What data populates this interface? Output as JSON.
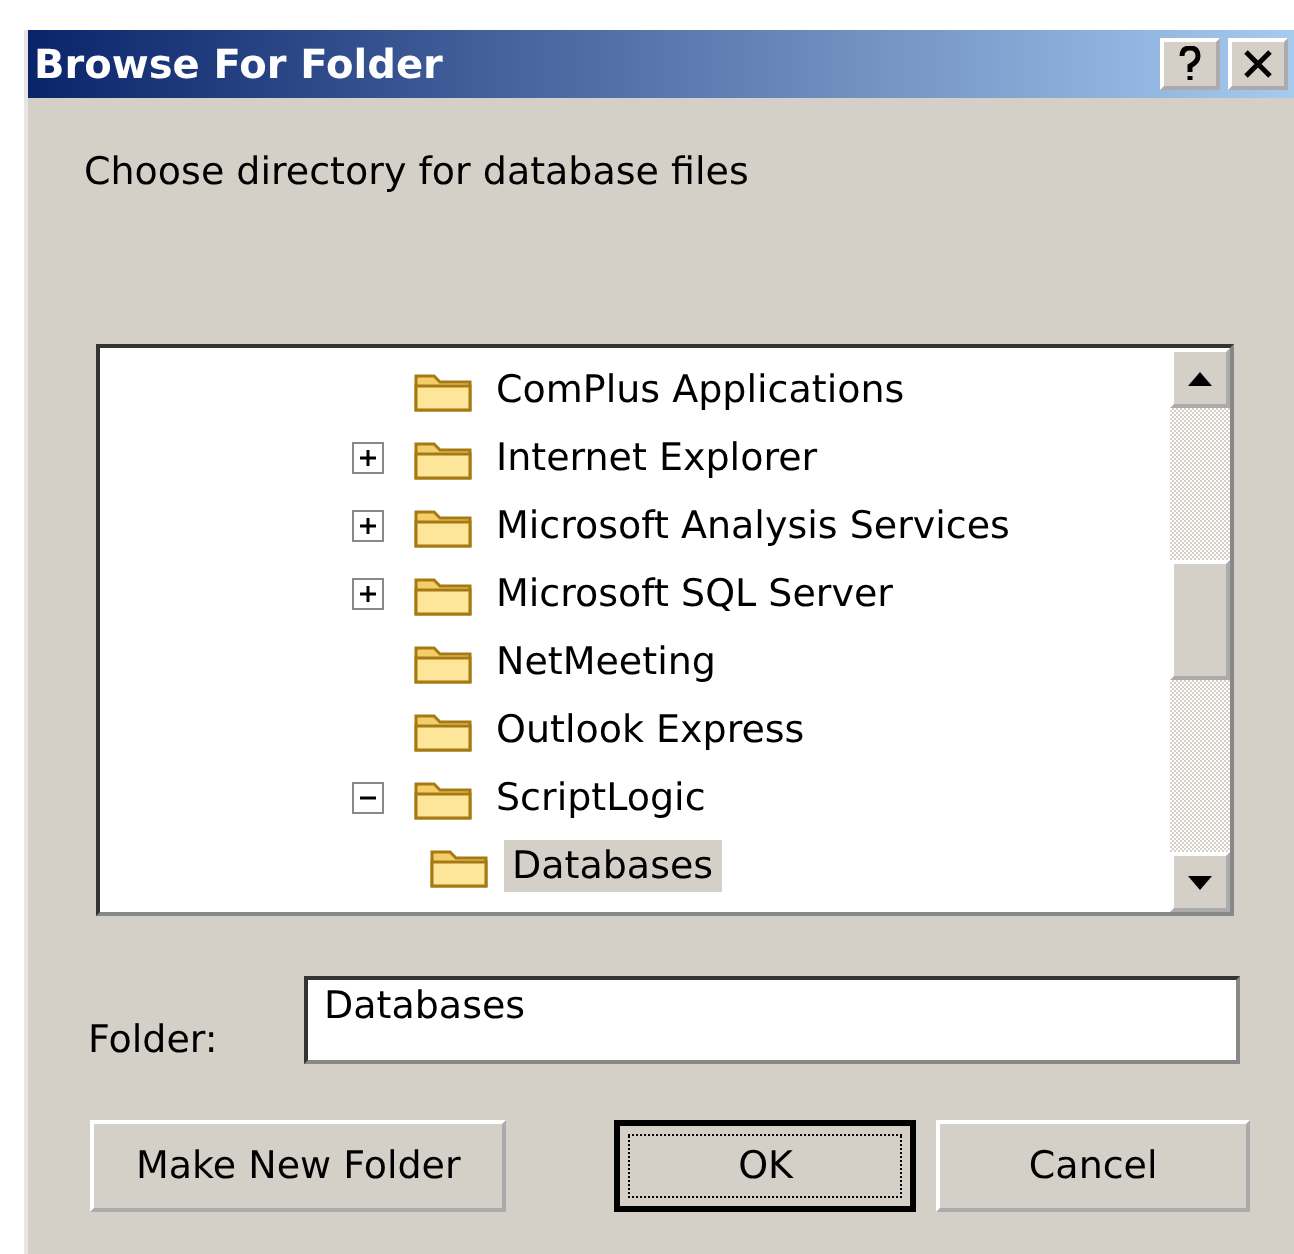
{
  "window": {
    "title": "Browse For Folder"
  },
  "prompt": "Choose directory for database files",
  "tree": {
    "items": [
      {
        "label": "ComPlus Applications",
        "kind": "leaf",
        "selected": false
      },
      {
        "label": "Internet Explorer",
        "kind": "collapsed",
        "selected": false
      },
      {
        "label": "Microsoft Analysis Services",
        "kind": "collapsed",
        "selected": false
      },
      {
        "label": "Microsoft SQL Server",
        "kind": "collapsed",
        "selected": false
      },
      {
        "label": "NetMeeting",
        "kind": "leaf",
        "selected": false
      },
      {
        "label": "Outlook Express",
        "kind": "leaf",
        "selected": false
      },
      {
        "label": "ScriptLogic",
        "kind": "expanded",
        "selected": false,
        "children": [
          {
            "label": "Databases",
            "kind": "leaf",
            "selected": true
          }
        ]
      }
    ]
  },
  "folder": {
    "label": "Folder:",
    "value": "Databases"
  },
  "buttons": [
    {
      "label": "Make New Folder",
      "default": false
    },
    {
      "label": "OK",
      "default": true
    },
    {
      "label": "Cancel",
      "default": false
    }
  ]
}
